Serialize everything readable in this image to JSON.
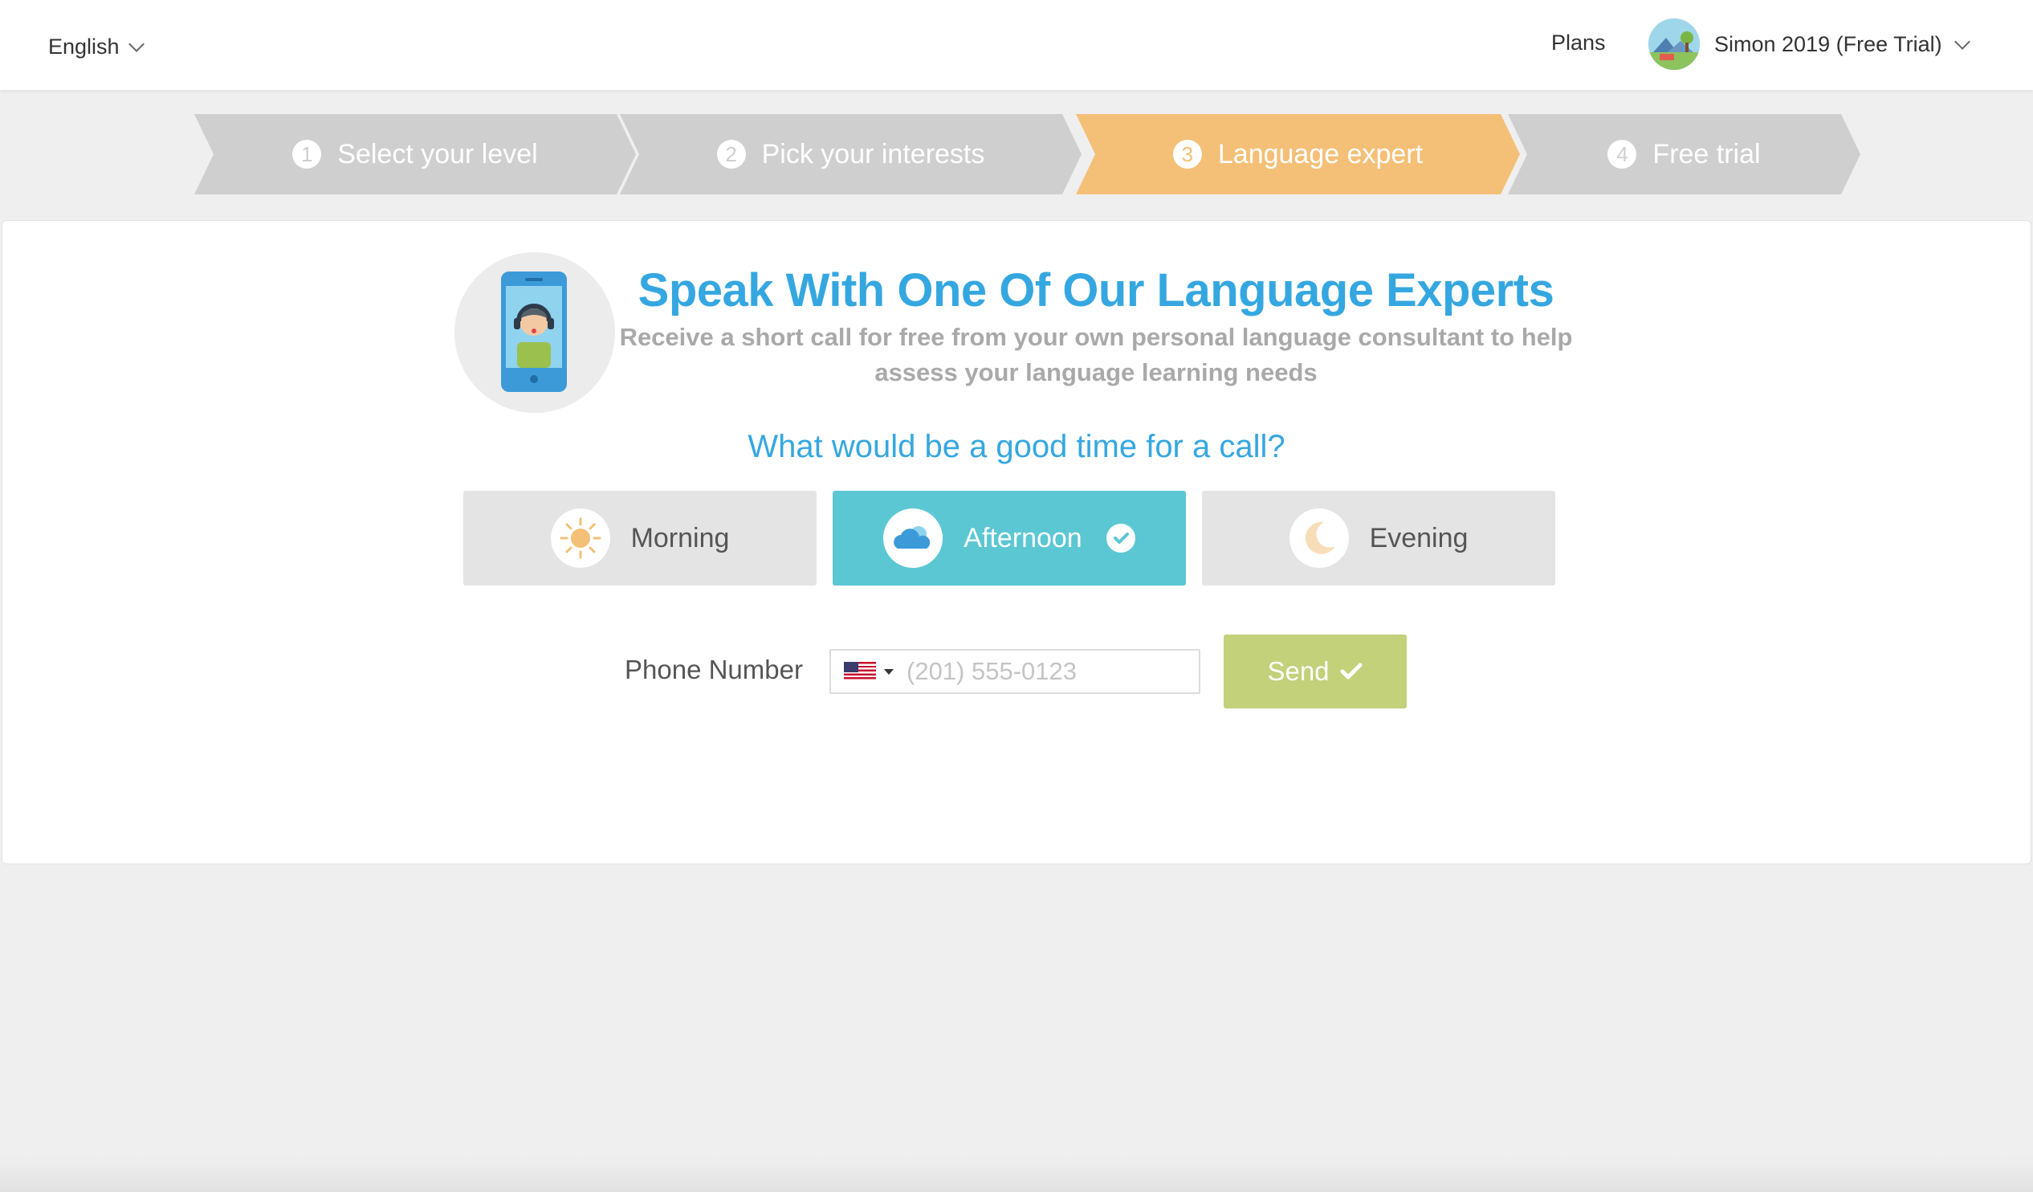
{
  "header": {
    "language_label": "English",
    "plans_label": "Plans",
    "user_label": "Simon 2019 (Free Trial)"
  },
  "stepper": {
    "steps": [
      {
        "number": "1",
        "label": "Select your level"
      },
      {
        "number": "2",
        "label": "Pick your interests"
      },
      {
        "number": "3",
        "label": "Language expert"
      },
      {
        "number": "4",
        "label": "Free trial"
      }
    ],
    "active_step": 3
  },
  "main": {
    "headline": "Speak With One Of Our Language Experts",
    "subtext": "Receive a short call for free from your own personal language consultant to help assess your language learning needs",
    "question": "What would be a good time for a call?",
    "time_options": [
      {
        "label": "Morning",
        "icon": "sun-icon"
      },
      {
        "label": "Afternoon",
        "icon": "cloud-icon"
      },
      {
        "label": "Evening",
        "icon": "moon-icon"
      }
    ],
    "selected_time": "Afternoon",
    "phone_label": "Phone Number",
    "phone_placeholder": "(201) 555-0123",
    "country_flag": "us-flag-icon",
    "send_label": "Send"
  },
  "colors": {
    "accent_blue": "#35a7e0",
    "active_step": "#f4c077",
    "selected_option": "#5bc7d3",
    "send_button": "#c2d17a"
  }
}
